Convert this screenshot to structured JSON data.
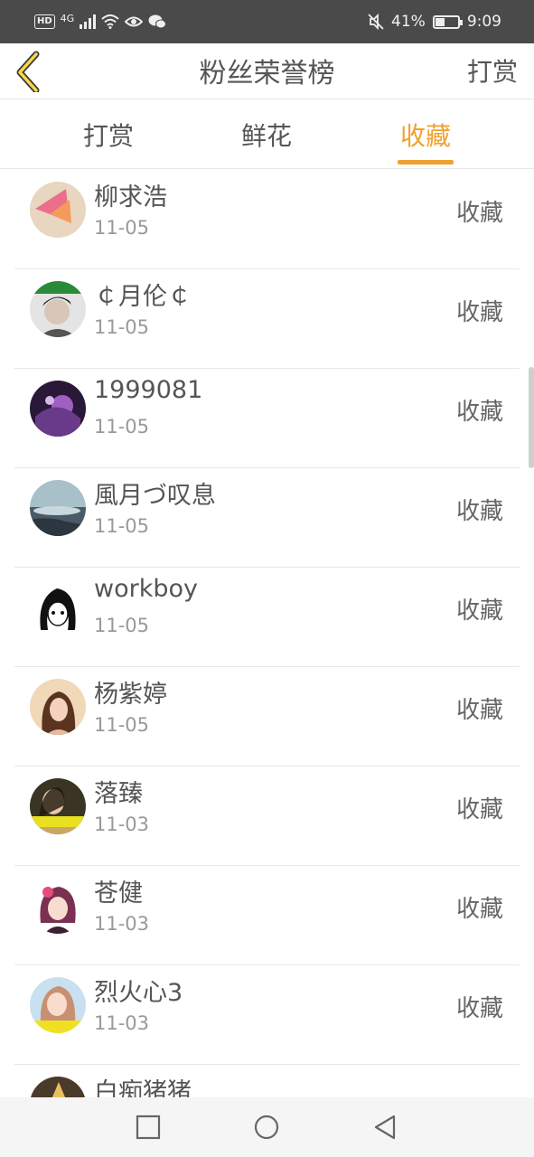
{
  "status_bar": {
    "badge": "HD",
    "network": "4G",
    "battery_text": "41%",
    "battery_level": 0.41,
    "time": "9:09"
  },
  "header": {
    "title": "粉丝荣誉榜",
    "action_label": "打赏"
  },
  "tabs": [
    {
      "label": "打赏",
      "active": false
    },
    {
      "label": "鲜花",
      "active": false
    },
    {
      "label": "收藏",
      "active": true
    }
  ],
  "fans": [
    {
      "name": "柳求浩",
      "date": "11-05",
      "action": "收藏"
    },
    {
      "name": "￠月伦￠",
      "date": "11-05",
      "action": "收藏"
    },
    {
      "name": "1999081",
      "date": "11-05",
      "action": "收藏"
    },
    {
      "name": "風月づ叹息",
      "date": "11-05",
      "action": "收藏"
    },
    {
      "name": "workboy",
      "date": "11-05",
      "action": "收藏"
    },
    {
      "name": "杨紫婷",
      "date": "11-05",
      "action": "收藏"
    },
    {
      "name": "落臻",
      "date": "11-03",
      "action": "收藏"
    },
    {
      "name": "苍健",
      "date": "11-03",
      "action": "收藏"
    },
    {
      "name": "烈火心3",
      "date": "11-03",
      "action": "收藏"
    },
    {
      "name": "白痴猪猪",
      "date": "",
      "action": ""
    }
  ],
  "colors": {
    "accent": "#f0a030",
    "status_bar": "#4a4a4a",
    "text": "#555555",
    "muted": "#999999"
  }
}
